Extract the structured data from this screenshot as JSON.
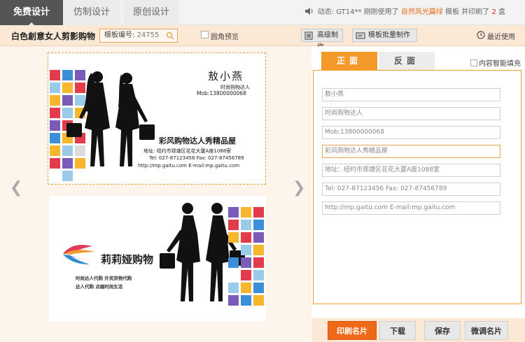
{
  "top_tabs": [
    {
      "label": "免费设计",
      "active": true
    },
    {
      "label": "仿制设计",
      "active": false
    },
    {
      "label": "原创设计",
      "active": false
    }
  ],
  "news": {
    "prefix": "动态:",
    "user": "GT14**",
    "action": "刚刚使用了",
    "template_name": "自然风光篇绿",
    "mid": "模板 并印刷了",
    "count": "2",
    "unit": "盒"
  },
  "subbar": {
    "title": "白色創意女人剪影购物",
    "template_no_label": "模板编号:",
    "template_no_value": "24755",
    "rounded_preview": "圆角预览",
    "advanced": "高级制作",
    "batch": "模板批量制作",
    "recent": "最近使用"
  },
  "card_front": {
    "name": "敖小燕",
    "title": "时尚购物达人",
    "mobile": "Mob:13800000068",
    "shop": "彩风购物达人秀精品屋",
    "address": "地址: 纽约市观塘区花花大厦A座1088室",
    "phone_fax": "Tel: 027-87123456  Fax: 027-87456789",
    "web_email": "http://mp.gaitu.com  E-mail:mp.gaitu.com"
  },
  "card_back": {
    "brand": "莉莉娅购物",
    "slogan1": "时尚达人代购  外贸货物代购",
    "slogan2": "达人代购  点缀时尚生活"
  },
  "panel": {
    "front_tab": "正面",
    "back_tab": "反面",
    "smart_fill": "内容智能填充",
    "fields": [
      "敖小燕",
      "时尚购物达人",
      "Mob:13800000068",
      "彩风购物达人秀精品屋",
      "地址：纽约市观塘区花花大厦A座1088室",
      "Tel: 027-87123456  Fax: 027-87456789",
      "http://mp.gaitu.com  E-mail:mp.gaitu.com"
    ]
  },
  "actions": {
    "print": "印刷名片",
    "download": "下载",
    "save": "保存",
    "tweak": "微调名片"
  },
  "colors": {
    "accent": "#ef6a18",
    "tab_orange": "#f39a2a",
    "peach": "#fbe9d6",
    "dark_tab": "#555555"
  }
}
